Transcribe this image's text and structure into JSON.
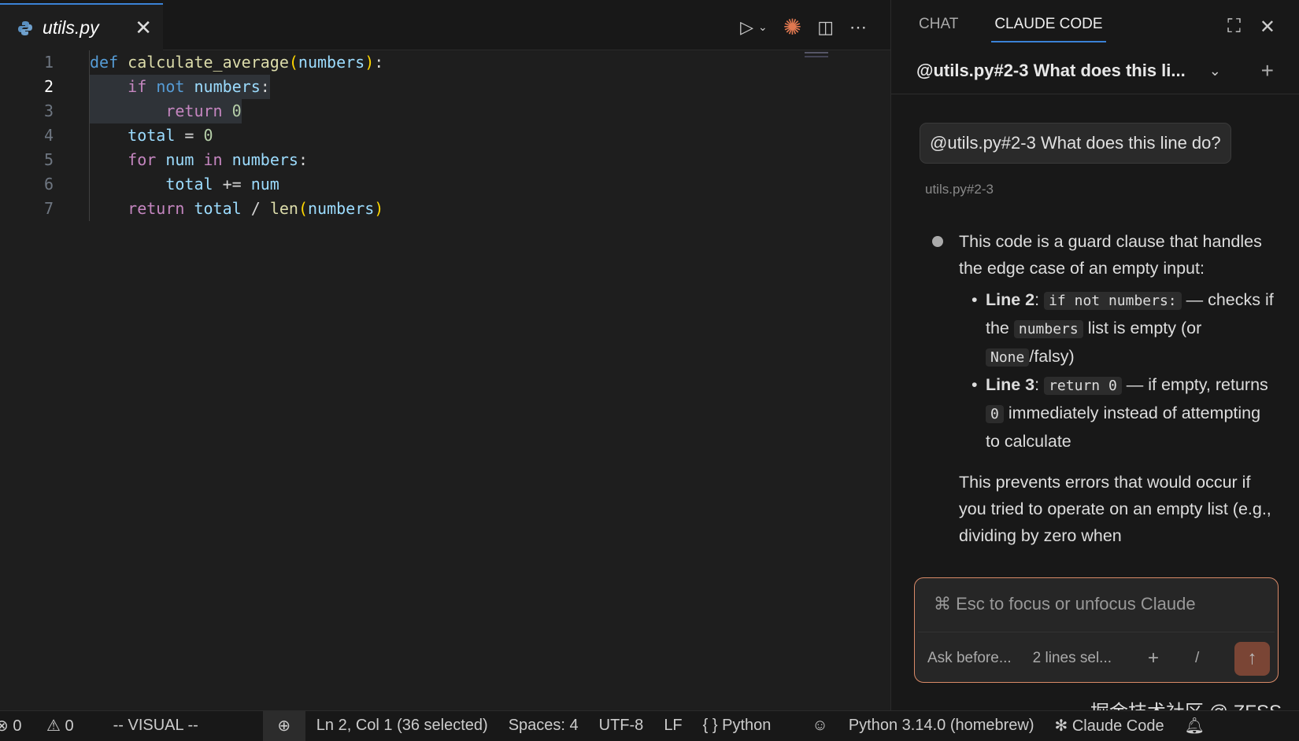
{
  "editor": {
    "tab": {
      "filename": "utils.py"
    },
    "lines": [
      {
        "n": "1",
        "tokens": [
          [
            "kw",
            "def"
          ],
          [
            "op",
            " "
          ],
          [
            "fn",
            "calculate_average"
          ],
          [
            "par",
            "("
          ],
          [
            "var",
            "numbers"
          ],
          [
            "par",
            ")"
          ],
          [
            "op",
            ":"
          ]
        ]
      },
      {
        "n": "2",
        "tokens": [
          [
            "op",
            "    "
          ],
          [
            "ctl",
            "if"
          ],
          [
            "op",
            " "
          ],
          [
            "kw",
            "not"
          ],
          [
            "op",
            " "
          ],
          [
            "var",
            "numbers"
          ],
          [
            "op",
            ":"
          ]
        ]
      },
      {
        "n": "3",
        "tokens": [
          [
            "op",
            "        "
          ],
          [
            "ctl",
            "return"
          ],
          [
            "op",
            " "
          ],
          [
            "num",
            "0"
          ]
        ]
      },
      {
        "n": "4",
        "tokens": [
          [
            "op",
            "    "
          ],
          [
            "var",
            "total"
          ],
          [
            "op",
            " = "
          ],
          [
            "num",
            "0"
          ]
        ]
      },
      {
        "n": "5",
        "tokens": [
          [
            "op",
            "    "
          ],
          [
            "ctl",
            "for"
          ],
          [
            "op",
            " "
          ],
          [
            "var",
            "num"
          ],
          [
            "op",
            " "
          ],
          [
            "ctl",
            "in"
          ],
          [
            "op",
            " "
          ],
          [
            "var",
            "numbers"
          ],
          [
            "op",
            ":"
          ]
        ]
      },
      {
        "n": "6",
        "tokens": [
          [
            "op",
            "        "
          ],
          [
            "var",
            "total"
          ],
          [
            "op",
            " += "
          ],
          [
            "var",
            "num"
          ]
        ]
      },
      {
        "n": "7",
        "tokens": [
          [
            "op",
            "    "
          ],
          [
            "ctl",
            "return"
          ],
          [
            "op",
            " "
          ],
          [
            "var",
            "total"
          ],
          [
            "op",
            " / "
          ],
          [
            "fn",
            "len"
          ],
          [
            "par",
            "("
          ],
          [
            "var",
            "numbers"
          ],
          [
            "par",
            ")"
          ]
        ]
      }
    ]
  },
  "panel": {
    "tabs": [
      "CHAT",
      "CLAUDE CODE"
    ],
    "title": "@utils.py#2-3 What does this li...",
    "user_message": "@utils.py#2-3 What does this line do?",
    "context": "utils.py#2-3",
    "response": {
      "intro": "This code is a guard clause that handles the edge case of an empty input:",
      "b1_label": "Line 2",
      "b1_code": "if not numbers:",
      "b1_a": " — checks if the ",
      "b1_code2": "numbers",
      "b1_b": " list is empty (or ",
      "b1_code3": "None",
      "b1_c": "/falsy)",
      "b2_label": "Line 3",
      "b2_code": "return 0",
      "b2_a": " — if empty, returns ",
      "b2_code2": "0",
      "b2_b": " immediately instead of attempting to calculate",
      "outro": "This prevents errors that would occur if you tried to operate on an empty list (e.g., dividing by zero when"
    },
    "input": {
      "placeholder": "⌘ Esc to focus or unfocus Claude",
      "mode": "Ask before...",
      "selection": "2 lines sel...",
      "plus": "+",
      "slash": "/"
    }
  },
  "status": {
    "errors": "0",
    "warnings": "0",
    "mode": "-- VISUAL --",
    "position": "Ln 2, Col 1 (36 selected)",
    "spaces": "Spaces: 4",
    "encoding": "UTF-8",
    "eol": "LF",
    "language": "Python",
    "interpreter": "Python 3.14.0 (homebrew)",
    "claude": "✻ Claude Code"
  },
  "watermark": "掘金技术社区 @ ZFSS"
}
